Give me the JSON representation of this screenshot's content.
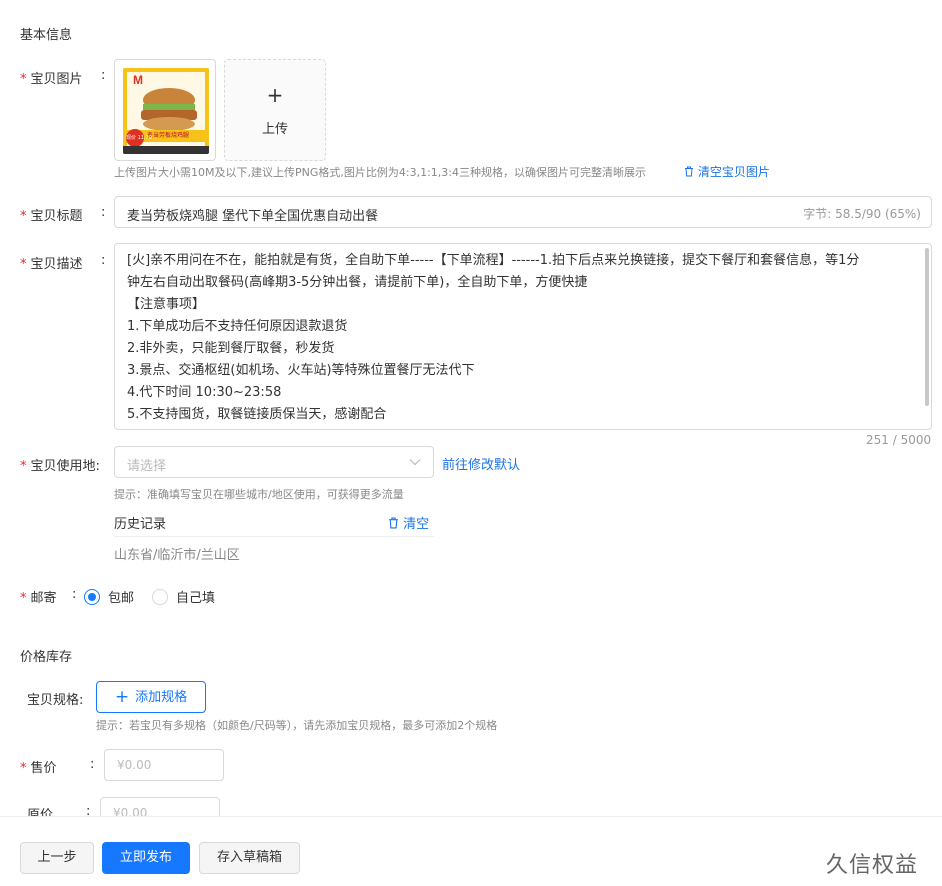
{
  "basic": {
    "section_title": "基本信息",
    "image_label": "宝贝图片",
    "upload_label": "上传",
    "image_hint": "上传图片大小需10M及以下,建议上传PNG格式,图片比例为4:3,1:1,3:4三种规格，以确保图片可完整清晰展示",
    "clear_images": "清空宝贝图片",
    "img_caption": "麦当劳板烧鸡腿",
    "img_price_tag": "现价 11.79",
    "title_label": "宝贝标题",
    "title_value": "麦当劳板烧鸡腿 堡代下单全国优惠自动出餐",
    "title_counter": "字节: 58.5/90 (65%)",
    "desc_label": "宝贝描述",
    "desc_lines": [
      "[火]亲不用问在不在，能拍就是有货，全自助下单-----【下单流程】------1.拍下后点来兑换链接，提交下餐厅和套餐信息，等1分",
      "钟左右自动出取餐码(高峰期3-5分钟出餐，请提前下单)，全自助下单，方便快捷",
      "【注意事项】",
      "1.下单成功后不支持任何原因退款退货",
      "2.非外卖，只能到餐厅取餐，秒发货",
      "3.景点、交通枢纽(如机场、火车站)等特殊位置餐厅无法代下",
      "4.代下时间 10:30~23:58",
      "5.不支持囤货，取餐链接质保当天，感谢配合"
    ],
    "desc_counter": "251 / 5000",
    "location_label": "宝贝使用地:",
    "location_placeholder": "请选择",
    "location_link": "前往修改默认",
    "location_hint": "提示：准确填写宝贝在哪些城市/地区使用，可获得更多流量",
    "history_label": "历史记录",
    "history_clear": "清空",
    "history_item": "山东省/临沂市/兰山区",
    "shipping_label": "邮寄",
    "shipping_opt1": "包邮",
    "shipping_opt2": "自己填"
  },
  "price": {
    "section_title": "价格库存",
    "spec_label": "宝贝规格:",
    "spec_button": "添加规格",
    "spec_hint": "提示：若宝贝有多规格（如颜色/尺码等），请先添加宝贝规格，最多可添加2个规格",
    "sale_label": "售价",
    "sale_placeholder": "¥0.00",
    "orig_label": "原价",
    "orig_placeholder": "¥0.00"
  },
  "footer": {
    "prev": "上一步",
    "publish": "立即发布",
    "draft": "存入草稿箱",
    "watermark": "久信权益"
  }
}
